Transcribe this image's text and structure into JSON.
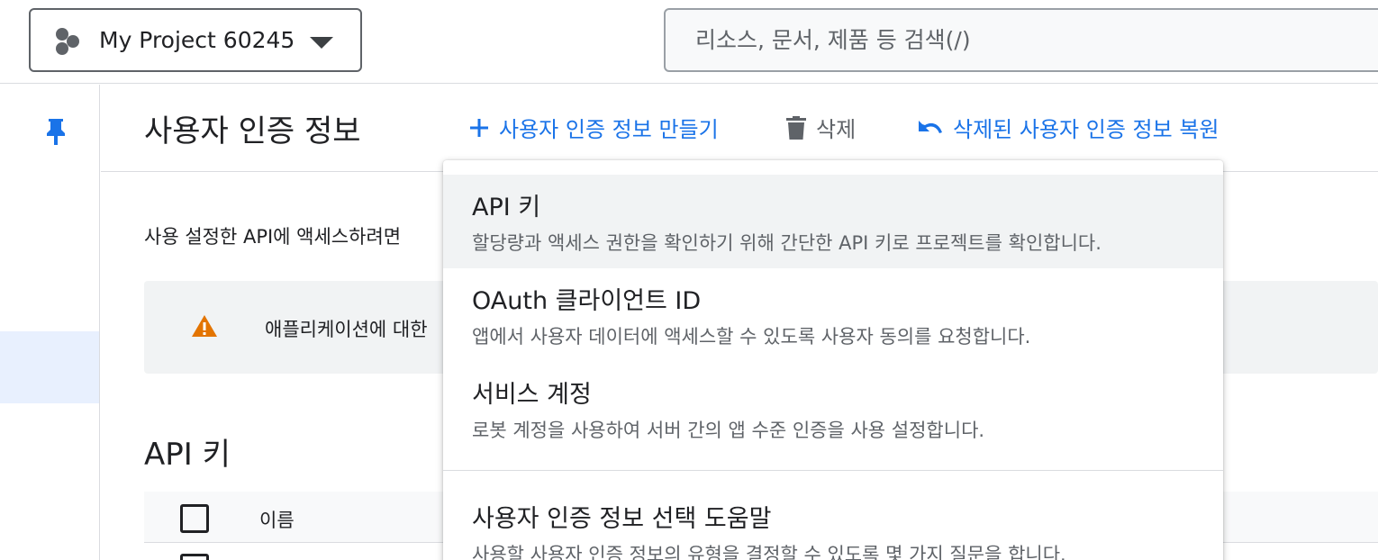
{
  "topbar": {
    "project_name": "My Project 60245",
    "search_placeholder": "리소스, 문서, 제품 등 검색(/)"
  },
  "header": {
    "title": "사용자 인증 정보",
    "create_label": "사용자 인증 정보 만들기",
    "delete_label": "삭제",
    "restore_label": "삭제된 사용자 인증 정보 복원"
  },
  "content": {
    "description": "사용 설정한 API에 액세스하려면",
    "warning_text": "애플리케이션에 대한",
    "api_keys_title": "API 키",
    "table": {
      "columns": [
        "이름"
      ]
    }
  },
  "menu": {
    "items": [
      {
        "title": "API 키",
        "desc": "할당량과 액세스 권한을 확인하기 위해 간단한 API 키로 프로젝트를 확인합니다."
      },
      {
        "title": "OAuth 클라이언트 ID",
        "desc": "앱에서 사용자 데이터에 액세스할 수 있도록 사용자 동의를 요청합니다."
      },
      {
        "title": "서비스 계정",
        "desc": "로봇 계정을 사용하여 서버 간의 앱 수준 인증을 사용 설정합니다."
      },
      {
        "title": "사용자 인증 정보 선택 도움말",
        "desc": "사용할 사용자 인증 정보의 유형을 결정할 수 있도록 몇 가지 질문을 합니다."
      }
    ]
  },
  "colors": {
    "accent": "#1a73e8",
    "warning": "#e37400",
    "pin": "#1a73e8"
  },
  "icons": [
    "project-hex-icon",
    "caret-down-icon",
    "pin-icon",
    "add-icon",
    "trash-icon",
    "undo-icon",
    "warning-icon"
  ]
}
